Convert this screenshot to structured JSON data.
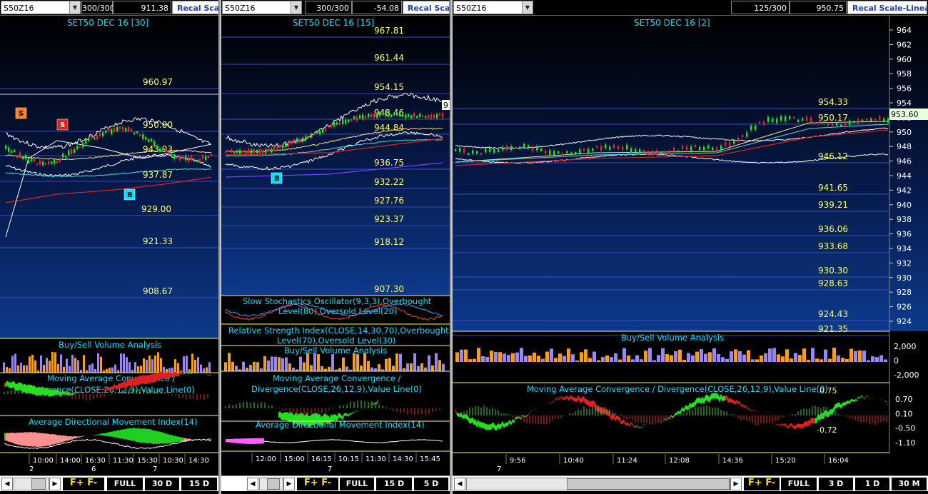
{
  "panes": [
    {
      "symbol": "S50Z16",
      "bars": "300/300",
      "value": "911.38",
      "recal": "Recal Scale",
      "title": "SET50 DEC 16  [30]",
      "price_levels": [
        "960.97",
        "950.00",
        "943.93",
        "937.87",
        "929.00",
        "921.33",
        "908.67"
      ],
      "markers": [
        "S",
        "S",
        "B"
      ],
      "indicators": [
        "Buy/Sell Volume Analysis",
        "Moving Average Convergence /",
        "Divergence(CLOSE,26,12,9),Value Line(0)",
        "Average Directional Movement Index(14)"
      ],
      "time_labels": [
        "10:00",
        "14:00",
        "16:30",
        "11:30",
        "15:30",
        "10:30",
        "14:30"
      ],
      "date_labels": [
        "2",
        "6",
        "7"
      ],
      "buttons": [
        "FULL",
        "30 D",
        "15 D"
      ]
    },
    {
      "symbol": "S50Z16",
      "bars": "300/300",
      "value": "-54.08",
      "recal": "Recal Scale",
      "title": "SET50 DEC 16  [15]",
      "price_levels": [
        "967.81",
        "961.44",
        "954.15",
        "948.46",
        "944.84",
        "936.75",
        "932.22",
        "927.76",
        "923.37",
        "918.12",
        "907.30"
      ],
      "edge_value": "9",
      "markers": [
        "B"
      ],
      "indicators": [
        "Slow Stochastics Oscillator(9,3,3),Overbought",
        "Level(80),Oversold Level(20)",
        "Relative Strength Index(CLOSE,14,30,70),Overbought",
        "Level(70),Oversold Level(30)",
        "Buy/Sell Volume Analysis",
        "Moving Average Convergence /",
        "Divergence(CLOSE,26,12,9),Value Line(0)",
        "Average Directional Movement Index(14)"
      ],
      "time_labels": [
        "12:00",
        "15:00",
        "16:15",
        "10:15",
        "11:30",
        "14:30",
        "15:45"
      ],
      "date_labels": [
        "7"
      ],
      "buttons": [
        "FULL",
        "15 D",
        "5 D"
      ]
    },
    {
      "symbol": "S50Z16",
      "bars": "125/300",
      "value": "950.75",
      "recal": "Recal Scale-Linear",
      "title": "SET50 DEC 16  [2]",
      "price_levels": [
        "954.33",
        "950.17",
        "946.12",
        "941.65",
        "939.21",
        "936.06",
        "933.68",
        "930.30",
        "928.63",
        "924.43",
        "921.35"
      ],
      "axis_labels": [
        "964",
        "962",
        "960",
        "958",
        "956",
        "954",
        "952",
        "950",
        "948",
        "946",
        "944",
        "942",
        "940",
        "938",
        "936",
        "934",
        "932",
        "930",
        "928",
        "926",
        "924"
      ],
      "current_price": "953.60",
      "indicators": [
        "Buy/Sell Volume Analysis",
        "Moving Average Convergence / Divergence(CLOSE,26,12,9),Value Line(0)"
      ],
      "volume_axis": [
        "2,000",
        "0",
        "-2,000"
      ],
      "macd_axis": [
        "0.70",
        "0.10",
        "-0.50",
        "-1.10"
      ],
      "macd_values": [
        "0.75",
        "-0.72"
      ],
      "time_labels": [
        "9:56",
        "10:40",
        "11:24",
        "12:08",
        "14:36",
        "15:20",
        "16:04"
      ],
      "date_labels": [
        "7"
      ],
      "buttons": [
        "FULL",
        "3 D",
        "1 D",
        "30 M"
      ]
    }
  ],
  "colors": {
    "title": "#00e0ff",
    "level": "#ffff66",
    "grid": "#3a4cc4",
    "price_up": "#00ff00",
    "price_down": "#ff2020",
    "marker_s": "#e02020",
    "marker_b": "#00e0ff"
  }
}
